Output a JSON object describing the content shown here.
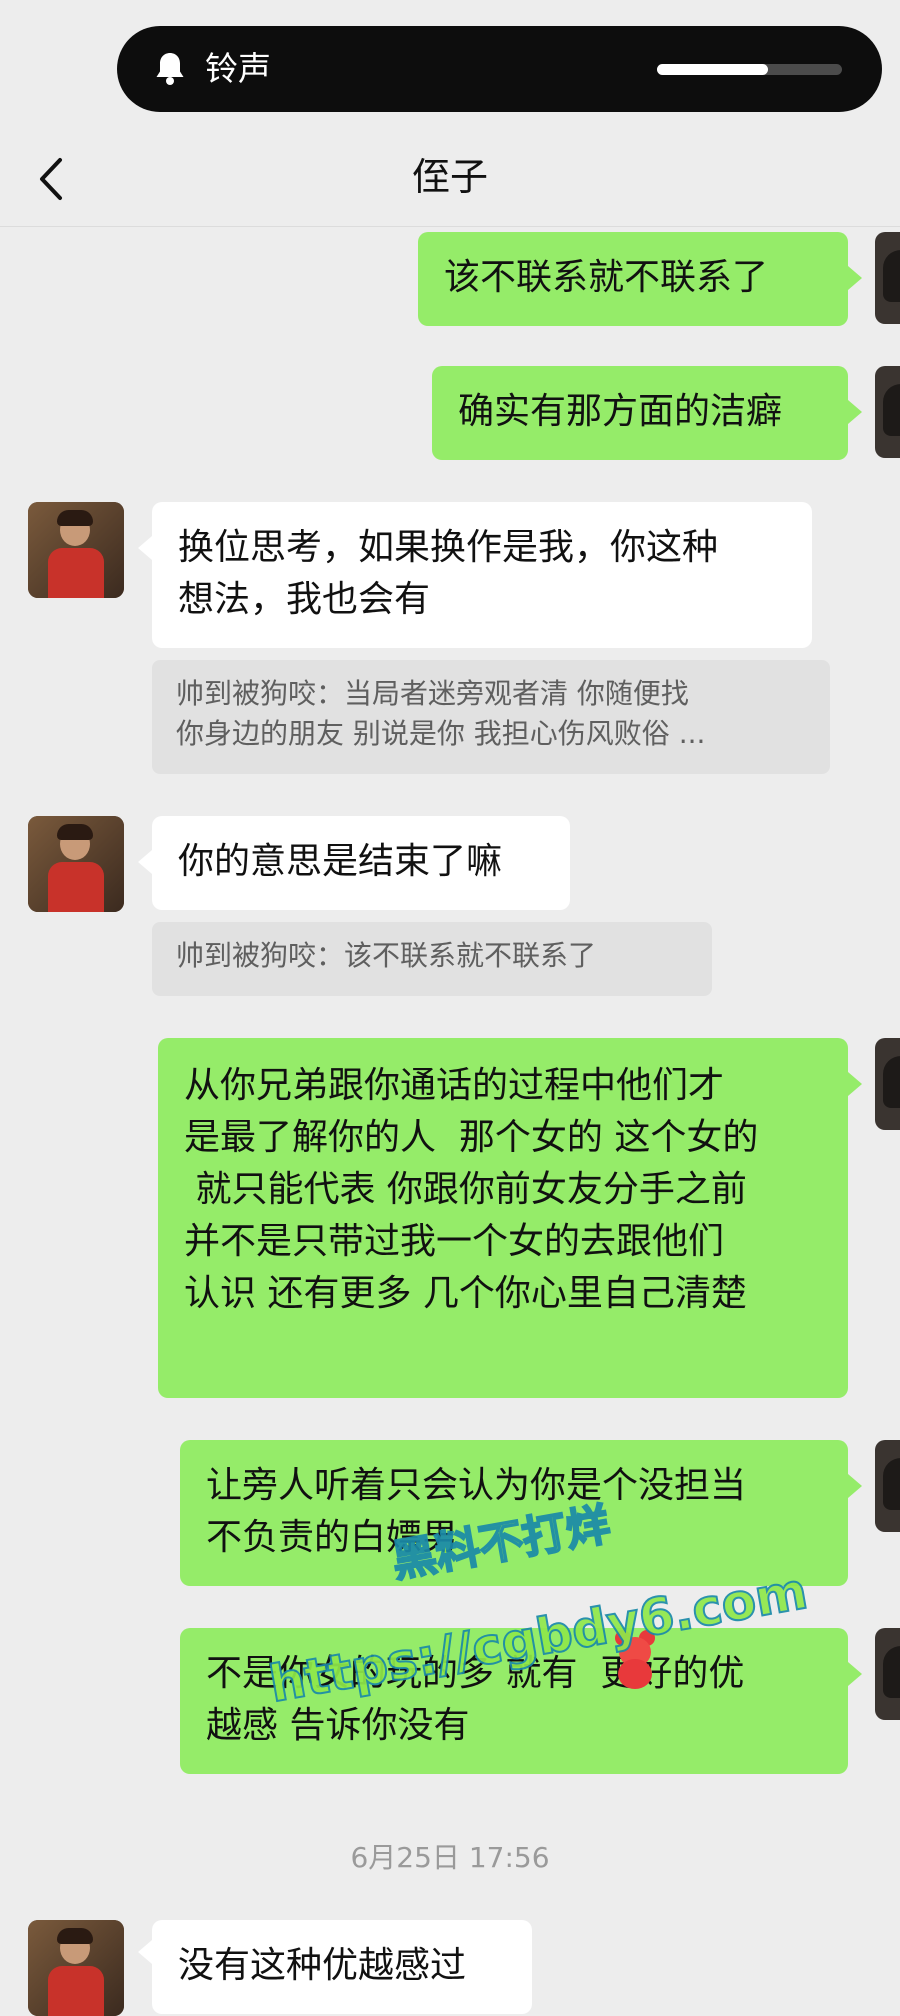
{
  "notification": {
    "label": "铃声",
    "icon": "bell-icon",
    "volume_fraction": 0.6
  },
  "header": {
    "title": "侄子",
    "back_icon": "chevron-left-icon"
  },
  "messages": [
    {
      "side": "out",
      "text": "该不联系就不联系了"
    },
    {
      "side": "out",
      "text": "确实有那方面的洁癖"
    },
    {
      "side": "in",
      "text": "换位思考，如果换作是我，你这种\n想法，我也会有",
      "quote": "帅到被狗咬：当局者迷旁观者清 你随便找\n你身边的朋友 别说是你 我担心伤风败俗 ..."
    },
    {
      "side": "in",
      "text": "你的意思是结束了嘛",
      "quote": "帅到被狗咬：该不联系就不联系了"
    },
    {
      "side": "out",
      "text": "从你兄弟跟你通话的过程中他们才\n是最了解你的人  那个女的 这个女的\n 就只能代表 你跟你前女友分手之前\n并不是只带过我一个女的去跟他们\n认识 还有更多 几个你心里自己清楚"
    },
    {
      "side": "out",
      "text": "让旁人听着只会认为你是个没担当\n不负责的白嫖男"
    },
    {
      "side": "out",
      "text": "不是你女的玩的多 就有  更好的优\n越感 告诉你没有"
    },
    {
      "side": "in",
      "text": "没有这种优越感过"
    }
  ],
  "timestamp": "6月25日 17:56",
  "watermark": {
    "line1": "黑料不打烊",
    "line2": "https://cgbdy6.com"
  },
  "colors": {
    "background": "#ededed",
    "outgoing_bubble": "#95ec69",
    "incoming_bubble": "#ffffff",
    "quote_bg": "#e1e1e1"
  }
}
